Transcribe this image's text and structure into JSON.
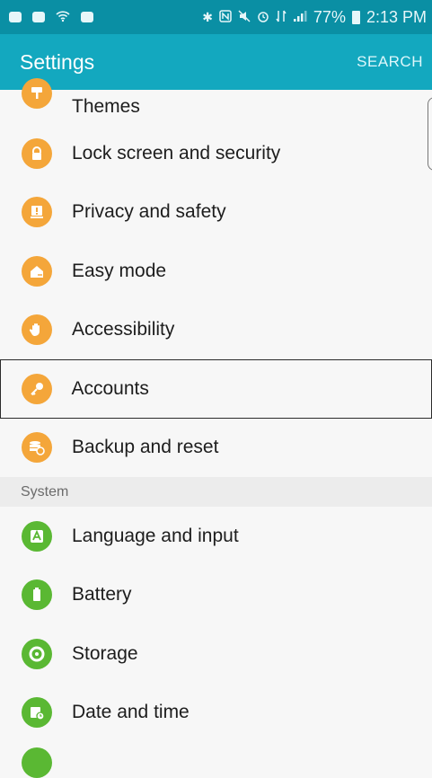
{
  "status_bar": {
    "battery_percent": "77%",
    "time": "2:13 PM",
    "icons": [
      "pay-icon",
      "mail-icon",
      "wifi-icon",
      "photo-icon",
      "bluetooth-icon",
      "nfc-icon",
      "mute-icon",
      "alarm-icon",
      "data-icon",
      "signal-icon",
      "battery-icon"
    ]
  },
  "app_bar": {
    "title": "Settings",
    "search_label": "SEARCH"
  },
  "menu_items": [
    {
      "label": "Themes"
    },
    {
      "label": "Lock screen and security"
    },
    {
      "label": "Privacy and safety"
    },
    {
      "label": "Easy mode"
    },
    {
      "label": "Accessibility"
    },
    {
      "label": "Accounts"
    },
    {
      "label": "Backup and reset"
    }
  ],
  "section": {
    "title": "System"
  },
  "system_items": [
    {
      "label": "Language and input"
    },
    {
      "label": "Battery"
    },
    {
      "label": "Storage"
    },
    {
      "label": "Date and time"
    }
  ],
  "colors": {
    "status_bar": "#0a8fa4",
    "app_bar": "#13a8bf",
    "orange_icon": "#f4a63a",
    "green_icon": "#5ab833"
  }
}
